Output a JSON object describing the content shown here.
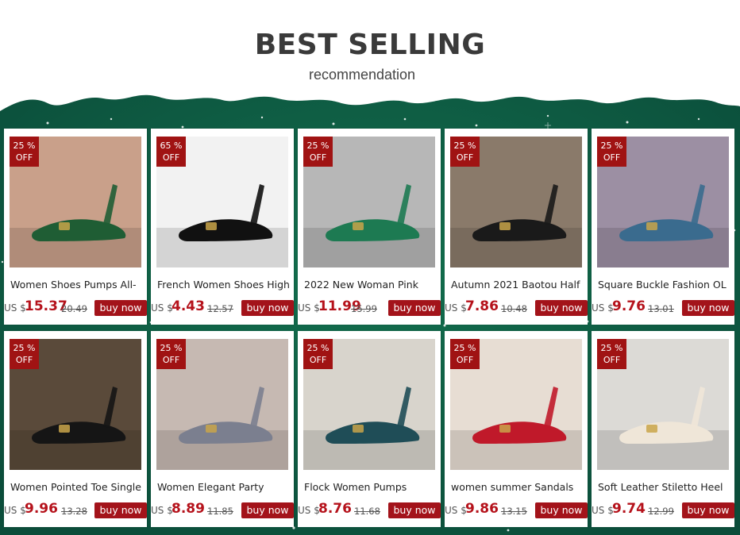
{
  "header": {
    "title": "BEST SELLING",
    "subtitle": "recommendation"
  },
  "colors": {
    "bg_green": "#0e5c45",
    "accent_red": "#a3131a",
    "price_red": "#b5121b"
  },
  "products": [
    {
      "discount_pct": "25 %",
      "discount_off": "OFF",
      "name": "Women Shoes Pumps All-",
      "currency": "US $",
      "price": "15.37",
      "old_price": "20.49",
      "button": "buy now"
    },
    {
      "discount_pct": "65 %",
      "discount_off": "OFF",
      "name": "French Women Shoes High",
      "currency": "US $",
      "price": "4.43",
      "old_price": "12.57",
      "button": "buy now"
    },
    {
      "discount_pct": "25 %",
      "discount_off": "OFF",
      "name": "2022 New Woman Pink",
      "currency": "US $",
      "price": "11.99",
      "old_price": "15.99",
      "button": "buy now"
    },
    {
      "discount_pct": "25 %",
      "discount_off": "OFF",
      "name": "Autumn 2021 Baotou Half",
      "currency": "US $",
      "price": "7.86",
      "old_price": "10.48",
      "button": "buy now"
    },
    {
      "discount_pct": "25 %",
      "discount_off": "OFF",
      "name": "Square Buckle Fashion OL",
      "currency": "US $",
      "price": "9.76",
      "old_price": "13.01",
      "button": "buy now"
    },
    {
      "discount_pct": "25 %",
      "discount_off": "OFF",
      "name": "Women Pointed Toe Single",
      "currency": "US $",
      "price": "9.96",
      "old_price": "13.28",
      "button": "buy now"
    },
    {
      "discount_pct": "25 %",
      "discount_off": "OFF",
      "name": "Women Elegant Party",
      "currency": "US $",
      "price": "8.89",
      "old_price": "11.85",
      "button": "buy now"
    },
    {
      "discount_pct": "25 %",
      "discount_off": "OFF",
      "name": "Flock Women Pumps",
      "currency": "US $",
      "price": "8.76",
      "old_price": "11.68",
      "button": "buy now"
    },
    {
      "discount_pct": "25 %",
      "discount_off": "OFF",
      "name": "women summer Sandals",
      "currency": "US $",
      "price": "9.86",
      "old_price": "13.15",
      "button": "buy now"
    },
    {
      "discount_pct": "25 %",
      "discount_off": "OFF",
      "name": "Soft Leather Stiletto Heel",
      "currency": "US $",
      "price": "9.74",
      "old_price": "12.99",
      "button": "buy now"
    }
  ]
}
